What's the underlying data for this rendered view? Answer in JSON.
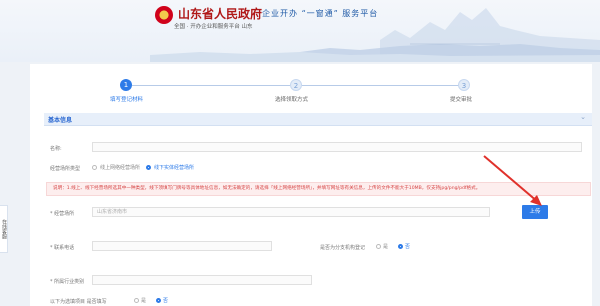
{
  "header": {
    "site_title": "山东省人民政府",
    "slogan": "企业开办 “一窗通” 服务平台",
    "subtitle": "全国 · 开办企业和服务平台 山东"
  },
  "steps": [
    {
      "number": "1",
      "label": "填写登记材料",
      "state": "active"
    },
    {
      "number": "2",
      "label": "选择领取方式",
      "state": "inactive"
    },
    {
      "number": "3",
      "label": "提交审批",
      "state": "inactive"
    }
  ],
  "section": {
    "title": "基本信息"
  },
  "fields": {
    "name_label": "名称:",
    "business_type_label": "经营场所类型",
    "business_type_options": [
      "线上网络经营场所",
      "线下实体经营场所"
    ],
    "business_type_selected": 1,
    "notice": "说明：1.线上、线下经营场所选其中一种类型，线下须填写门牌号等具体地址信息，如无法确定的，请选择「线上网络经营场所」，并填写网址等有关信息，上传的文件不能大于10MB，仅支持jpg/png/pdf格式。",
    "address_label": "* 经营场所",
    "address_value": "山东省济南市",
    "upload_label": "上传",
    "tel_label": "* 联系电话",
    "other_label": "是否为分支机构登记",
    "other_options": [
      "是",
      "否"
    ],
    "other_selected": 1,
    "industry_label": "* 所属行业类别",
    "bottom_label": "以下为选填项目 是否填写",
    "bottom_options": [
      "是",
      "否"
    ],
    "bottom_selected": 1
  },
  "side_tab": {
    "label": "在线客服"
  },
  "colors": {
    "accent": "#2d7be8",
    "brand_red": "#b01818",
    "notice_red": "#d64545"
  }
}
